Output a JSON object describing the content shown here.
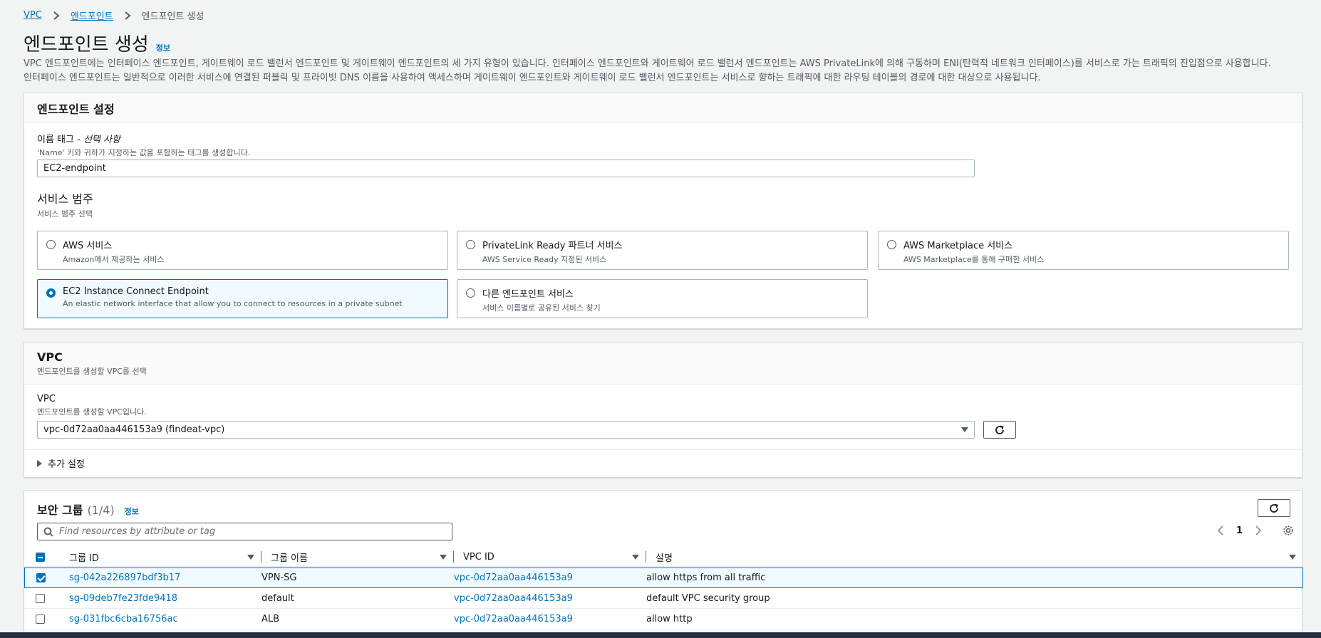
{
  "breadcrumb": {
    "items": [
      "VPC",
      "엔드포인트"
    ],
    "current": "엔드포인트 생성"
  },
  "page": {
    "title": "엔드포인트 생성",
    "info": "정보",
    "description_line1": "VPC 엔드포인트에는 인터페이스 엔드포인트, 게이트웨이 로드 밸런서 엔드포인트 및 게이트웨이 엔드포인트의 세 가지 유형이 있습니다. 인터페이스 엔드포인트와 게이트웨어 로드 밸런서 엔드포인트는 AWS PrivateLink에 의해 구동하며 ENI(탄력적 네트워크 인터페이스)를 서비스로 가는 트래픽의 진입점으로 사용합니다.",
    "description_line2": "인터페이스 엔드포인트는 일반적으로 이러한 서비스에 연결된 퍼블릭 및 프라이빗 DNS 이름을 사용하여 액세스하며 게이트웨이 엔드포인트와 게이트웨이 로드 밸런서 엔드포인트는 서비스로 향하는 트래픽에 대한 라우팅 테이블의 경로에 대한 대상으로 사용됩니다."
  },
  "endpoint_settings": {
    "header": "엔드포인트 설정",
    "name_label_prefix": "이름 태그 - ",
    "name_label_optional": "선택 사항",
    "name_desc": "'Name' 키와 귀하가 지정하는 값을 포함하는 태그를 생성합니다.",
    "name_value": "EC2-endpoint",
    "category_title": "서비스 범주",
    "category_desc": "서비스 범주 선택",
    "tiles": [
      {
        "title": "AWS 서비스",
        "desc": "Amazon에서 제공하는 서비스",
        "selected": false
      },
      {
        "title": "PrivateLink Ready 파트너 서비스",
        "desc": "AWS Service Ready 지정된 서비스",
        "selected": false
      },
      {
        "title": "AWS Marketplace 서비스",
        "desc": "AWS Marketplace를 통해 구매한 서비스",
        "selected": false
      },
      {
        "title": "EC2 Instance Connect Endpoint",
        "desc": "An elastic network interface that allow you to connect to resources in a private subnet",
        "selected": true
      },
      {
        "title": "다른 엔드포인트 서비스",
        "desc": "서비스 이름별로 공유된 서비스 찾기",
        "selected": false
      }
    ]
  },
  "vpc_panel": {
    "header": "VPC",
    "header_desc": "엔드포인트를 생성할 VPC를 선택",
    "field_label": "VPC",
    "field_desc": "엔드포인트를 생성할 VPC입니다.",
    "selected": "vpc-0d72aa0aa446153a9 (findeat-vpc)",
    "additional_settings": "추가 설정"
  },
  "security_groups": {
    "title": "보안 그룹",
    "count": "(1/4)",
    "info": "정보",
    "search_placeholder": "Find resources by attribute or tag",
    "page": "1",
    "columns": [
      "그룹 ID",
      "그룹 이름",
      "VPC ID",
      "설명"
    ],
    "rows": [
      {
        "id": "sg-042a226897bdf3b17",
        "name": "VPN-SG",
        "vpc": "vpc-0d72aa0aa446153a9",
        "desc": "allow https from all traffic",
        "checked": true
      },
      {
        "id": "sg-09deb7fe23fde9418",
        "name": "default",
        "vpc": "vpc-0d72aa0aa446153a9",
        "desc": "default VPC security group",
        "checked": false
      },
      {
        "id": "sg-031fbc6cba16756ac",
        "name": "ALB",
        "vpc": "vpc-0d72aa0aa446153a9",
        "desc": "allow http",
        "checked": false
      }
    ]
  },
  "colors": {
    "accent": "#0073bb",
    "text": "#16191f",
    "secondary": "#545b64",
    "border": "#aab7b8"
  },
  "icons": [
    "chevron-right-icon",
    "radio-icon",
    "caret-down-icon",
    "refresh-icon",
    "caret-right-icon",
    "search-icon",
    "chevron-left-icon",
    "gear-icon",
    "checkbox-icon",
    "sort-icon"
  ]
}
